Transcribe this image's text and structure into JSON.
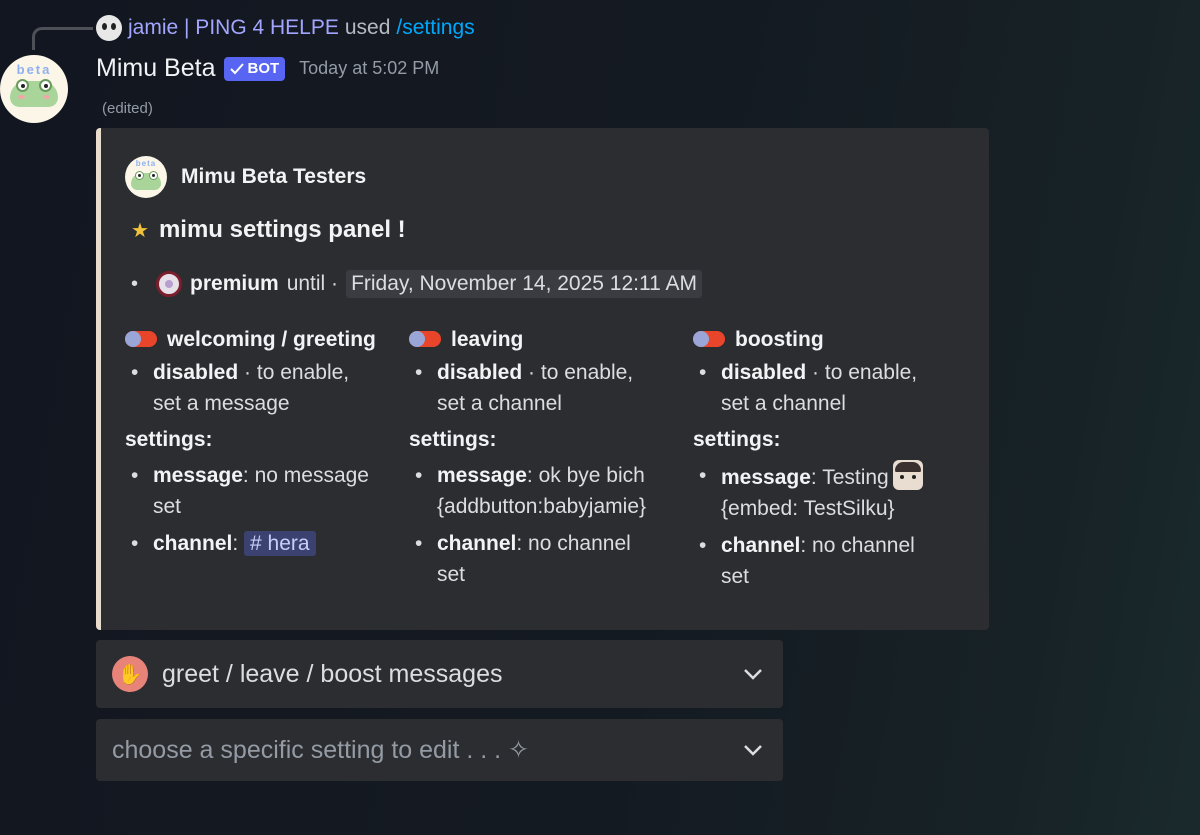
{
  "reply": {
    "user": "jamie | PING 4 HELPE",
    "verb": "used",
    "command": "/settings"
  },
  "message": {
    "author": "Mimu Beta",
    "bot_label": "BOT",
    "timestamp": "Today at 5:02 PM",
    "edited": "(edited)",
    "avatar_text": "beta"
  },
  "embed": {
    "author": "Mimu Beta Testers",
    "title": "mimu settings panel !",
    "premium": {
      "label": "premium",
      "until": "until ·",
      "date": "Friday, November 14, 2025 12:11 AM"
    },
    "settings_label": "settings:",
    "columns": [
      {
        "title": "welcoming / greeting",
        "status": "disabled",
        "status_hint_1": "· to enable,",
        "status_hint_2": "set a message",
        "message_label": "message",
        "message_value_1": ": no message",
        "message_value_2": "set",
        "channel_label": "channel",
        "channel_sep": ":",
        "channel_value": "# hera"
      },
      {
        "title": "leaving",
        "status": "disabled",
        "status_hint_1": "· to enable,",
        "status_hint_2": "set a channel",
        "message_label": "message",
        "message_value_1": ": ok bye bich",
        "message_value_2": "{addbutton:babyjamie}",
        "channel_label": "channel",
        "channel_value_1": ": no channel",
        "channel_value_2": "set"
      },
      {
        "title": "boosting",
        "status": "disabled",
        "status_hint_1": "· to enable,",
        "status_hint_2": "set a channel",
        "message_label": "message",
        "message_value_1": ": Testing",
        "message_value_2": "{embed: TestSilku}",
        "channel_label": "channel",
        "channel_value_1": ": no channel",
        "channel_value_2": "set"
      }
    ]
  },
  "selects": {
    "first": {
      "label": "greet / leave / boost messages",
      "icon": "wave-icon"
    },
    "second": {
      "placeholder": "choose a specific setting to edit . . . ✧"
    }
  },
  "colors": {
    "embed_border": "#e8dccc",
    "bot_badge": "#5865f2",
    "command_link": "#00a8fc",
    "toggle_off": "#e8452a"
  }
}
